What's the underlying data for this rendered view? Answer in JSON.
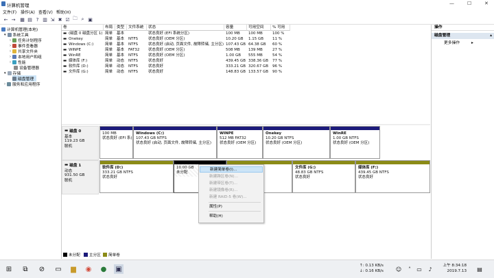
{
  "window": {
    "title": "计算机管理"
  },
  "menu": [
    "文件(F)",
    "操作(A)",
    "查看(V)",
    "帮助(H)"
  ],
  "tree": [
    {
      "label": "计算机管理(本地)",
      "icon": "computer-icon"
    },
    {
      "label": "系统工具",
      "icon": "tools-icon"
    },
    {
      "label": "任务计划程序",
      "icon": "clock-icon"
    },
    {
      "label": "事件查看器",
      "icon": "event-icon"
    },
    {
      "label": "共享文件夹",
      "icon": "folder-icon"
    },
    {
      "label": "本地用户和组",
      "icon": "users-icon"
    },
    {
      "label": "性能",
      "icon": "performance-icon"
    },
    {
      "label": "设备管理器",
      "icon": "device-icon"
    },
    {
      "label": "存储",
      "icon": "storage-icon"
    },
    {
      "label": "磁盘管理",
      "icon": "disk-icon"
    },
    {
      "label": "服务和应用程序",
      "icon": "services-icon"
    }
  ],
  "volumes": {
    "headers": [
      "卷",
      "布局",
      "类型",
      "文件系统",
      "状态",
      "容量",
      "可用空间",
      "% 可用"
    ],
    "rows": [
      [
        "(磁盘 0 磁盘分区 1)",
        "简单",
        "基本",
        "",
        "状态良好 (EFI 系统分区)",
        "100 MB",
        "100 MB",
        "100 %"
      ],
      [
        "Onekey",
        "简单",
        "基本",
        "NTFS",
        "状态良好 (OEM 分区)",
        "10.20 GB",
        "1.15 GB",
        "11 %"
      ],
      [
        "Windows (C:)",
        "简单",
        "基本",
        "NTFS",
        "状态良好 (启动, 页面文件, 故障转储, 主分区)",
        "107.43 GB",
        "64.38 GB",
        "60 %"
      ],
      [
        "WINPE",
        "简单",
        "基本",
        "FAT32",
        "状态良好 (OEM 分区)",
        "508 MB",
        "139 MB",
        "27 %"
      ],
      [
        "WinRE",
        "简单",
        "基本",
        "NTFS",
        "状态良好 (OEM 分区)",
        "1.00 GB",
        "555 MB",
        "54 %"
      ],
      [
        "媒体库 (F:)",
        "简单",
        "动态",
        "NTFS",
        "状态良好",
        "439.45 GB",
        "338.36 GB",
        "77 %"
      ],
      [
        "软件库 (D:)",
        "简单",
        "动态",
        "NTFS",
        "状态良好",
        "333.21 GB",
        "320.67 GB",
        "96 %"
      ],
      [
        "文件库 (G:)",
        "简单",
        "动态",
        "NTFS",
        "状态良好",
        "148.83 GB",
        "133.57 GB",
        "90 %"
      ]
    ]
  },
  "disk0": {
    "name": "磁盘 0",
    "type": "基本",
    "size": "119.23 GB",
    "status": "联机",
    "partitions": [
      {
        "name": "",
        "size": "100 MB",
        "status": "状态良好 (EFI 系)"
      },
      {
        "name": "Windows (C:)",
        "size": "107.43 GB NTFS",
        "status": "状态良好 (启动, 页面文件, 故障转储, 主分区)"
      },
      {
        "name": "WINPE",
        "size": "512 MB FAT32",
        "status": "状态良好 (OEM 分区)"
      },
      {
        "name": "Onekey",
        "size": "10.20 GB NTFS",
        "status": "状态良好 (OEM 分区)"
      },
      {
        "name": "WinRE",
        "size": "1.00 GB NTFS",
        "status": "状态良好 (OEM 分区)"
      }
    ]
  },
  "disk1": {
    "name": "磁盘 1",
    "type": "动态",
    "size": "931.50 GB",
    "status": "联机",
    "partitions": [
      {
        "name": "软件库 (D:)",
        "size": "333.21 GB NTFS",
        "status": "状态良好"
      },
      {
        "name": "",
        "size": "10.00 GB",
        "status": "未分配"
      },
      {
        "name": "文件库 (G:)",
        "size": "48.83 GB NTFS",
        "status": "状态良好"
      },
      {
        "name": "媒体库 (F:)",
        "size": "439.45 GB NTFS",
        "status": "状态良好"
      }
    ]
  },
  "legend": [
    "未分配",
    "主分区",
    "简单卷"
  ],
  "actions": {
    "header": "操作",
    "section": "磁盘管理",
    "more": "更多操作"
  },
  "context_menu": [
    {
      "label": "新建简单卷(I)...",
      "enabled": true
    },
    {
      "label": "新建跨区卷(N)...",
      "enabled": false
    },
    {
      "label": "新建带区卷(T)...",
      "enabled": false
    },
    {
      "label": "新建镜像卷(R)...",
      "enabled": false
    },
    {
      "label": "新建 RAID-5 卷(W)...",
      "enabled": false
    },
    {
      "label": "属性(P)",
      "enabled": true
    },
    {
      "label": "帮助(H)",
      "enabled": true
    }
  ],
  "taskbar": {
    "net_up": "↑: 0.13 KB/s",
    "net_down": "↓: 0.16 KB/s",
    "time": "上午 8:34:18",
    "date": "2019.7.13"
  },
  "colors": {
    "disk0_bar": "#1b1a7a",
    "disk1_bar": "#8b8b16",
    "unalloc": "#000000",
    "highlight": "#cce4f7"
  }
}
